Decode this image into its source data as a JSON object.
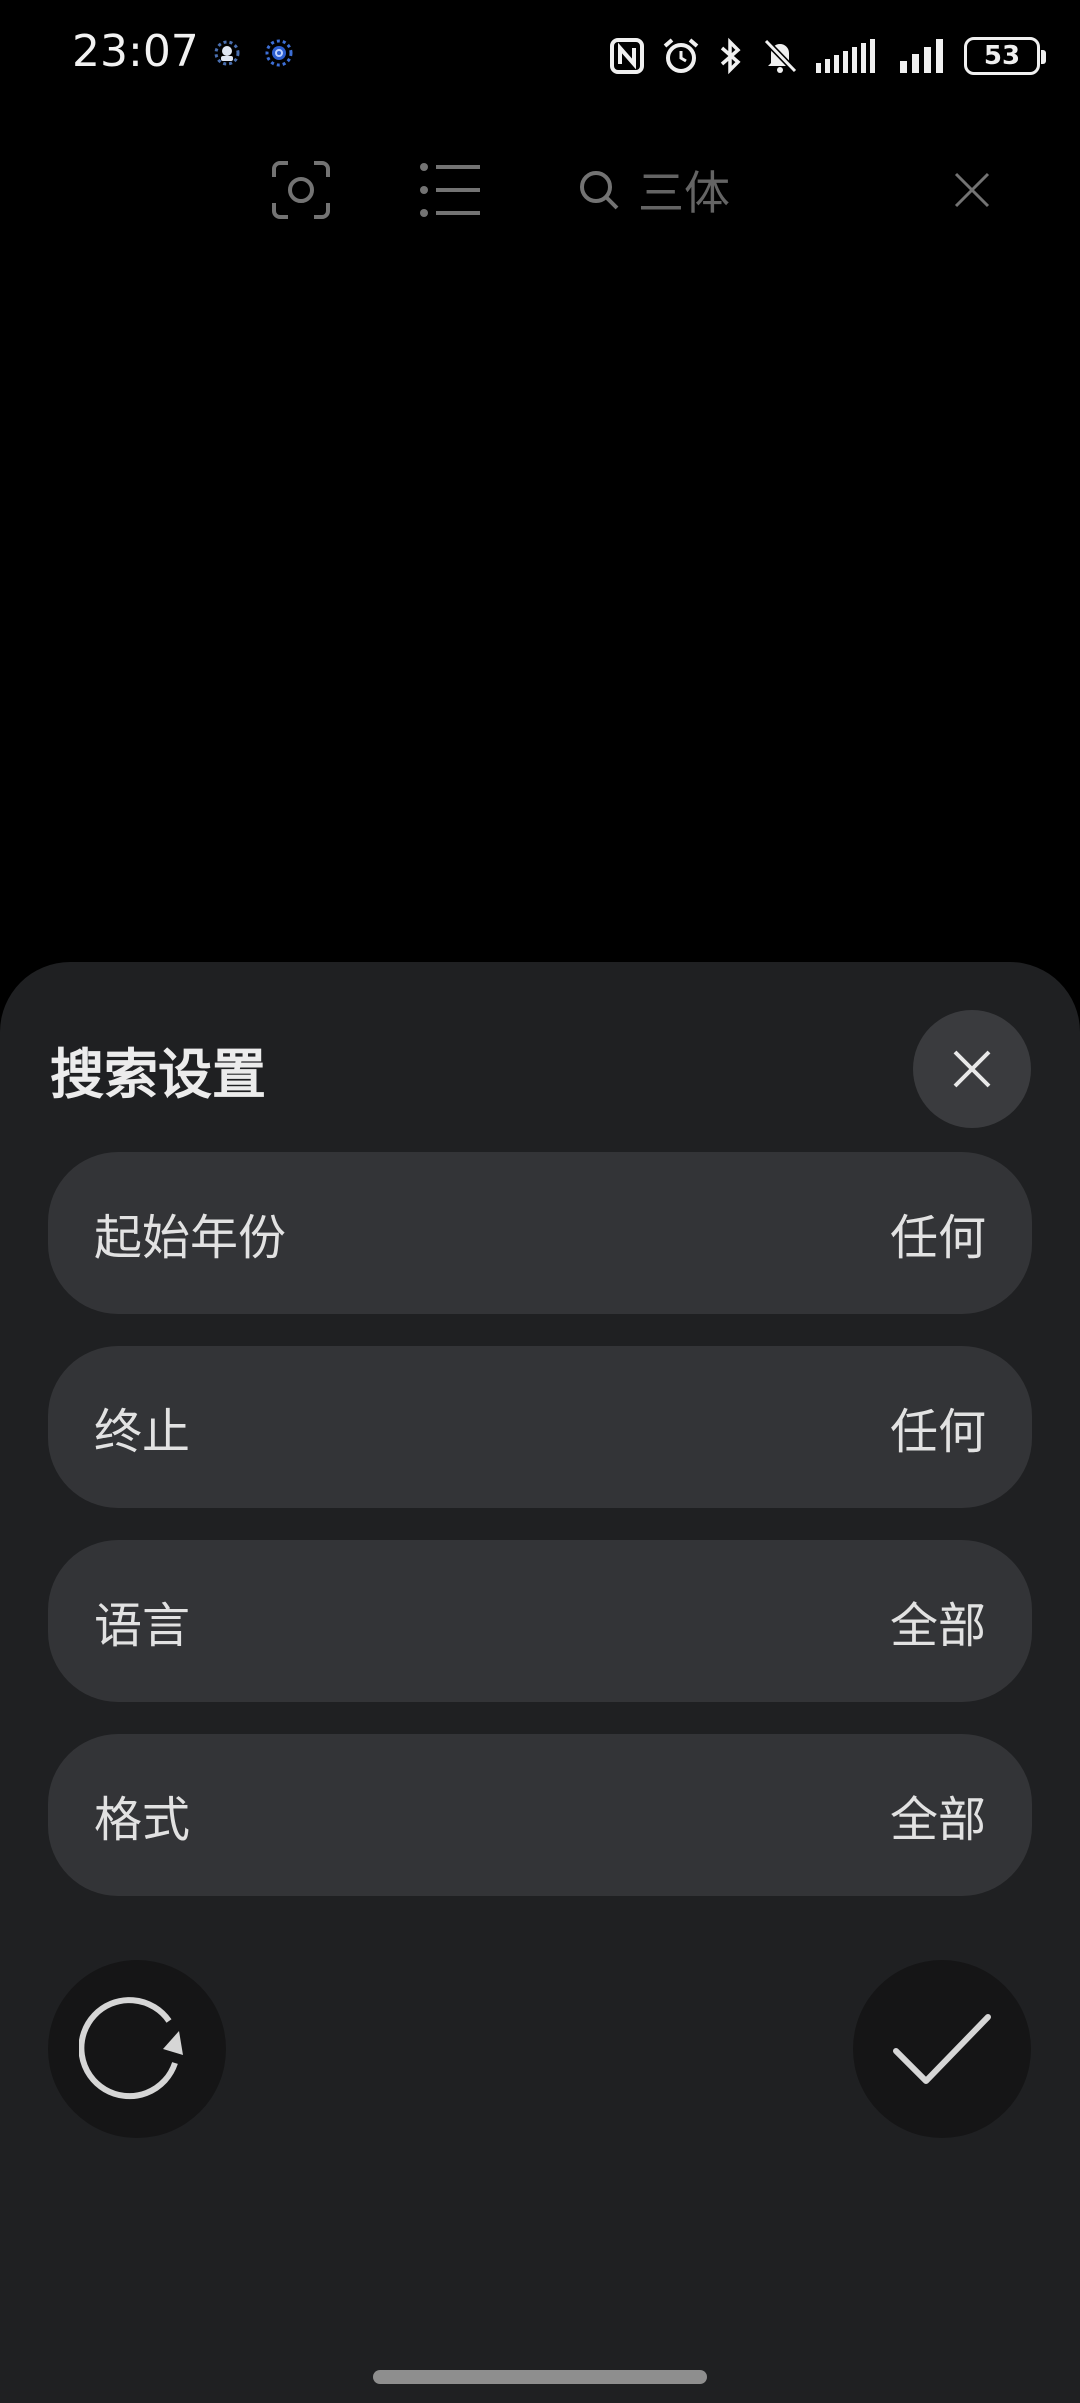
{
  "status_bar": {
    "time": "23:07",
    "battery": "53",
    "icons": [
      "app-notification-icon",
      "app-notification-icon-2",
      "nfc-icon",
      "alarm-icon",
      "bluetooth-icon",
      "mute-icon",
      "signal-icon",
      "signal-icon-2",
      "battery-icon"
    ]
  },
  "toolbar": {
    "search_query": "三体",
    "icons": [
      "scan-icon",
      "list-icon",
      "search-icon",
      "close-icon"
    ]
  },
  "sheet": {
    "title": "搜索设置",
    "options": [
      {
        "label": "起始年份",
        "value": "任何"
      },
      {
        "label": "终止",
        "value": "任何"
      },
      {
        "label": "语言",
        "value": "全部"
      },
      {
        "label": "格式",
        "value": "全部"
      }
    ],
    "icons": [
      "close-icon",
      "reset-icon",
      "confirm-check-icon"
    ]
  },
  "colors": {
    "background": "#000000",
    "sheet": "#1f2022",
    "row": "#333437",
    "round_button": "#151516"
  }
}
